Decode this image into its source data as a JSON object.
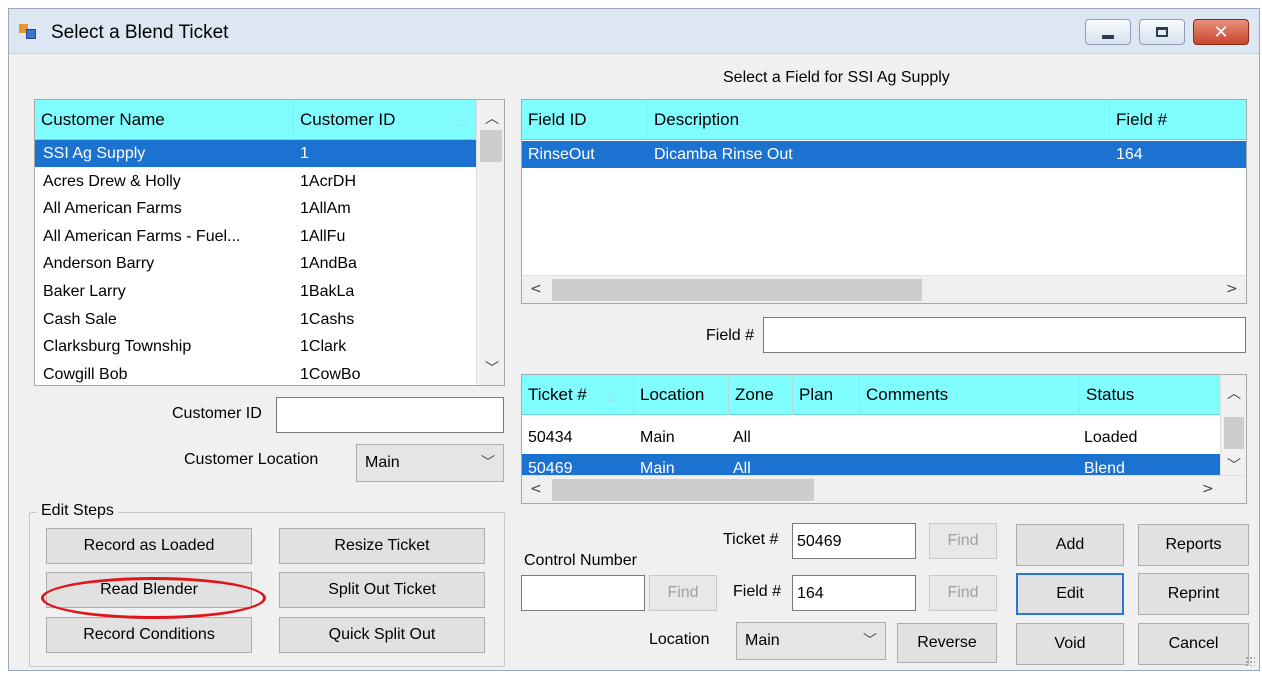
{
  "window": {
    "title": "Select a Blend Ticket",
    "close_glyph": "✕"
  },
  "customers": {
    "columns": [
      "Customer Name",
      "Customer ID"
    ],
    "sort_glyph": "△",
    "rows": [
      {
        "name": "SSI Ag Supply",
        "id": "1",
        "selected": true
      },
      {
        "name": "Acres Drew & Holly",
        "id": "1AcrDH"
      },
      {
        "name": "All American Farms",
        "id": "1AllAm"
      },
      {
        "name": "All American Farms - Fuel...",
        "id": "1AllFu"
      },
      {
        "name": "Anderson Barry",
        "id": "1AndBa"
      },
      {
        "name": "Baker Larry",
        "id": "1BakLa"
      },
      {
        "name": "Cash Sale",
        "id": "1Cashs"
      },
      {
        "name": "Clarksburg Township",
        "id": "1Clark"
      },
      {
        "name": "Cowgill Bob",
        "id": "1CowBo"
      }
    ]
  },
  "customer_id": {
    "label": "Customer ID",
    "value": ""
  },
  "customer_location": {
    "label": "Customer Location",
    "value": "Main"
  },
  "fields": {
    "caption": "Select a Field for SSI Ag Supply",
    "columns": [
      "Field ID",
      "Description",
      "Field #"
    ],
    "rows": [
      {
        "field_id": "RinseOut",
        "description": "Dicamba Rinse Out",
        "field_no": "164",
        "selected": true
      }
    ]
  },
  "field_search": {
    "label": "Field #",
    "value": ""
  },
  "tickets": {
    "columns": [
      "Ticket #",
      "Location",
      "Zone",
      "Plan",
      "Comments",
      "Status"
    ],
    "sort_glyph": "△",
    "rows": [
      {
        "ticket": "50434",
        "location": "Main",
        "zone": "All",
        "plan": "",
        "comments": "",
        "status": "Loaded"
      },
      {
        "ticket": "50469",
        "location": "Main",
        "zone": "All",
        "plan": "",
        "comments": "",
        "status": "Blend",
        "selected": true
      }
    ]
  },
  "edit_steps": {
    "title": "Edit Steps",
    "buttons": {
      "record_loaded": "Record as Loaded",
      "resize_ticket": "Resize Ticket",
      "read_blender": "Read Blender",
      "split_out": "Split Out Ticket",
      "record_conditions": "Record Conditions",
      "quick_split": "Quick Split Out"
    }
  },
  "control_number": {
    "label": "Control Number",
    "value": "",
    "find": "Find"
  },
  "ticket_no": {
    "label": "Ticket #",
    "value": "50469",
    "find": "Find"
  },
  "field_no": {
    "label": "Field #",
    "value": "164",
    "find": "Find"
  },
  "location": {
    "label": "Location",
    "value": "Main"
  },
  "actions": {
    "add": "Add",
    "reports": "Reports",
    "edit": "Edit",
    "reprint": "Reprint",
    "void": "Void",
    "cancel": "Cancel",
    "reverse": "Reverse"
  },
  "annotation": {
    "color": "#e0151b",
    "target": "read-blender-button"
  }
}
